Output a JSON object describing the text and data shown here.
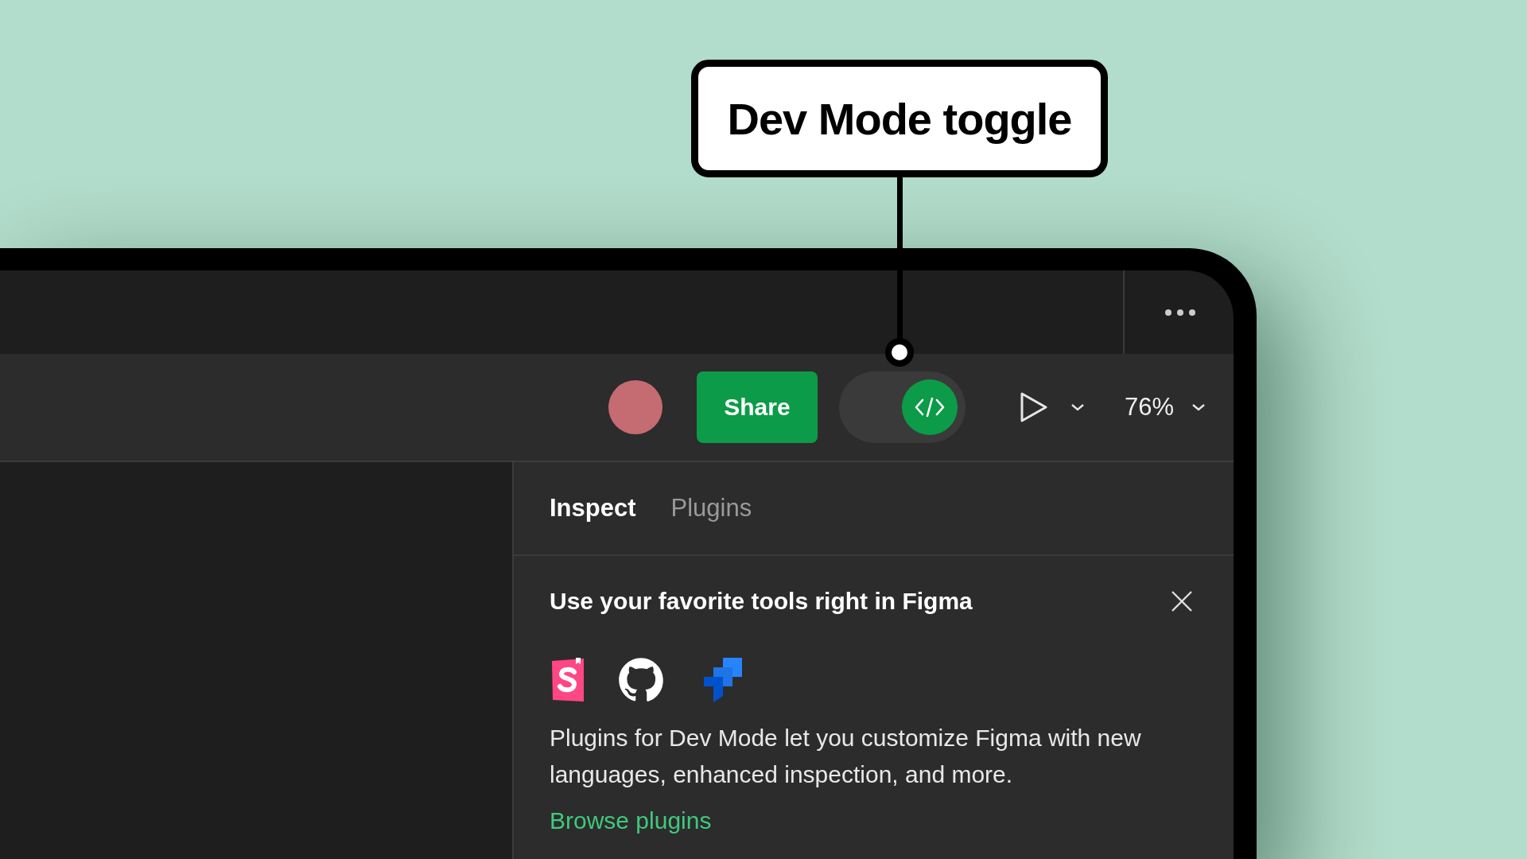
{
  "callout": {
    "label": "Dev Mode toggle"
  },
  "toolbar": {
    "share_button": "Share",
    "dev_mode": {
      "on": true
    },
    "zoom": "76%"
  },
  "panel": {
    "tabs": [
      {
        "label": "Inspect",
        "selected": true
      },
      {
        "label": "Plugins",
        "selected": false
      }
    ],
    "banner": {
      "title": "Use your favorite tools right in Figma",
      "text": "Plugins for Dev Mode let you customize Figma with new languages, enhanced inspection, and more.",
      "link": "Browse plugins"
    }
  }
}
